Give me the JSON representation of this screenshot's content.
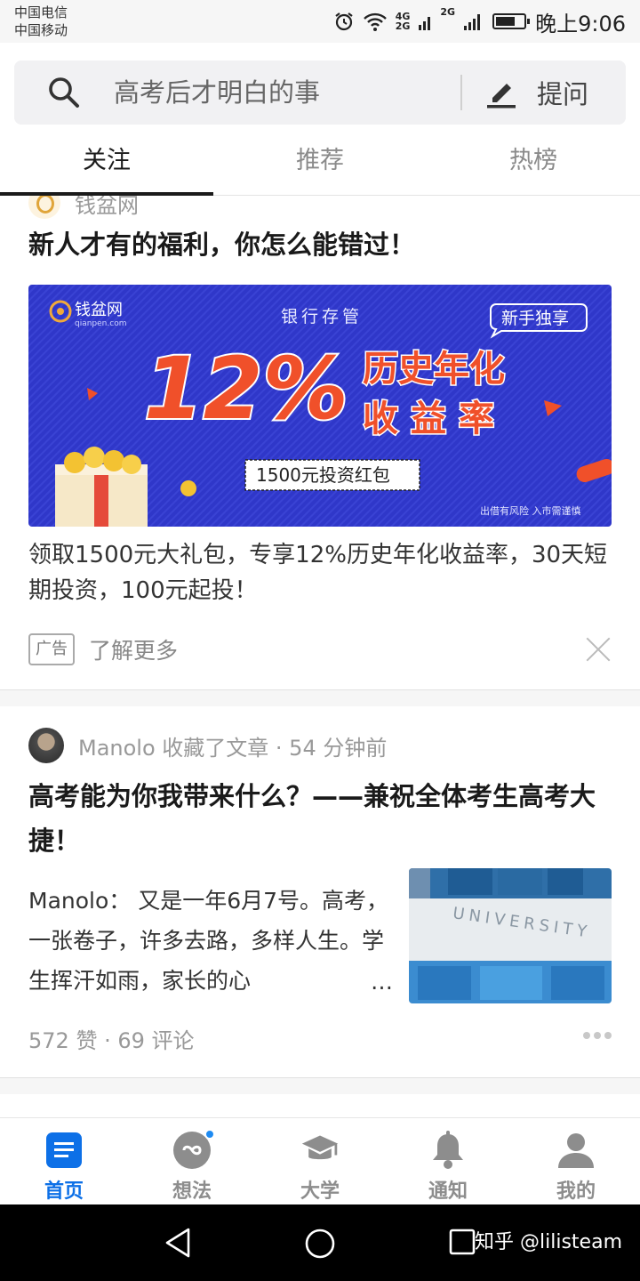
{
  "status_bar": {
    "carrier_1": "中国电信",
    "carrier_2": "中国移动",
    "network_1": "4G",
    "network_2": "2G",
    "network_3": "2G",
    "battery_level": 0.7,
    "time": "晚上9:06"
  },
  "search": {
    "placeholder": "高考后才明白的事",
    "ask_label": "提问"
  },
  "tabs": [
    {
      "label": "关注",
      "active": true
    },
    {
      "label": "推荐",
      "active": false
    },
    {
      "label": "热榜",
      "active": false
    }
  ],
  "ad_card": {
    "source": "钱盆网",
    "title": "新人才有的福利，你怎么能错过！",
    "banner": {
      "logo_text": "钱盆网",
      "logo_domain": "qianpen.com",
      "top_text": "银行存管",
      "badge": "新手独享",
      "rate": "12%",
      "rate_desc_1": "历史年化",
      "rate_desc_2": "收益率",
      "packet": "1500元投资红包",
      "disclaimer": "出借有风险  入市需谨慎",
      "background": "#2f37c9"
    },
    "description": "领取1500元大礼包，专享12%历史年化收益率，30天短期投资，100元起投！",
    "tag": "广告",
    "learn_more": "了解更多"
  },
  "article_card": {
    "meta": "Manolo 收藏了文章 · 54 分钟前",
    "title": "高考能为你我带来什么？——兼祝全体考生高考大捷！",
    "excerpt": "Manolo： 又是一年6月7号。高考，一张卷子，许多去路，多样人生。学生挥汗如雨，家长的心",
    "ellipsis": "…",
    "thumbnail_text": "UNIVERSITY",
    "stats": "572 赞 · 69 评论"
  },
  "bottom_nav": [
    {
      "label": "首页",
      "icon": "home-icon",
      "active": true
    },
    {
      "label": "想法",
      "icon": "ideas-icon",
      "active": false
    },
    {
      "label": "大学",
      "icon": "graduation-cap-icon",
      "active": false
    },
    {
      "label": "通知",
      "icon": "bell-icon",
      "active": false
    },
    {
      "label": "我的",
      "icon": "user-icon",
      "active": false
    }
  ],
  "watermark": "知乎 @lilisteam",
  "colors": {
    "accent": "#0d70e7",
    "banner_blue": "#2f37c9",
    "banner_orange": "#f0502a"
  }
}
